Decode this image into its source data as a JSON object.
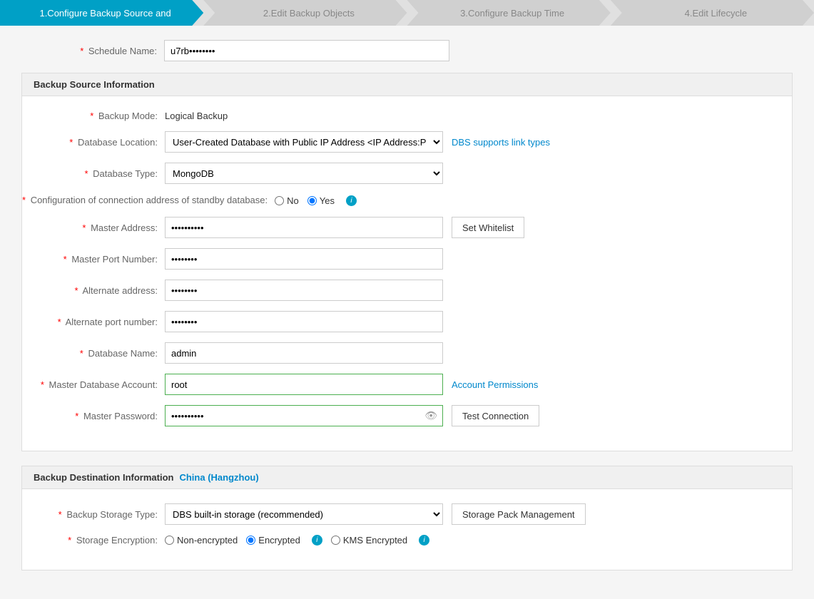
{
  "progress": {
    "steps": [
      {
        "id": "step1",
        "label": "1.Configure Backup Source and",
        "active": true
      },
      {
        "id": "step2",
        "label": "2.Edit Backup Objects",
        "active": false
      },
      {
        "id": "step3",
        "label": "3.Configure Backup Time",
        "active": false
      },
      {
        "id": "step4",
        "label": "4.Edit Lifecycle",
        "active": false
      }
    ]
  },
  "schedule": {
    "name_label": "Schedule Name:",
    "name_value": "u7rb••••••••"
  },
  "backup_source": {
    "section_title": "Backup Source Information",
    "backup_mode_label": "Backup Mode:",
    "backup_mode_value": "Logical Backup",
    "db_location_label": "Database Location:",
    "db_location_value": "User-Created Database with Public IP Address <IP Address:Port Num",
    "db_location_options": [
      "User-Created Database with Public IP Address <IP Address:Port Num"
    ],
    "dbs_link": "DBS supports link types",
    "db_type_label": "Database Type:",
    "db_type_value": "MongoDB",
    "db_type_options": [
      "MongoDB"
    ],
    "standby_label": "Configuration of connection address of standby database:",
    "standby_no": "No",
    "standby_yes": "Yes",
    "master_address_label": "Master Address:",
    "master_address_placeholder": "••••••••••",
    "set_whitelist_btn": "Set Whitelist",
    "master_port_label": "Master Port Number:",
    "master_port_placeholder": "••••••••",
    "alt_address_label": "Alternate address:",
    "alt_address_placeholder": "••••••••",
    "alt_port_label": "Alternate port number:",
    "alt_port_placeholder": "••••••••",
    "db_name_label": "Database Name:",
    "db_name_value": "admin",
    "master_account_label": "Master Database Account:",
    "master_account_value": "root",
    "account_permissions_link": "Account Permissions",
    "master_password_label": "Master Password:",
    "master_password_value": "••••••••••",
    "test_connection_btn": "Test Connection"
  },
  "backup_destination": {
    "section_title": "Backup Destination Information",
    "region": "China (Hangzhou)",
    "storage_type_label": "Backup Storage Type:",
    "storage_type_value": "DBS built-in storage (recommended)",
    "storage_type_options": [
      "DBS built-in storage (recommended)"
    ],
    "storage_pack_btn": "Storage Pack Management",
    "encryption_label": "Storage Encryption:",
    "non_encrypted": "Non-encrypted",
    "encrypted": "Encrypted",
    "kms_encrypted": "KMS Encrypted"
  }
}
